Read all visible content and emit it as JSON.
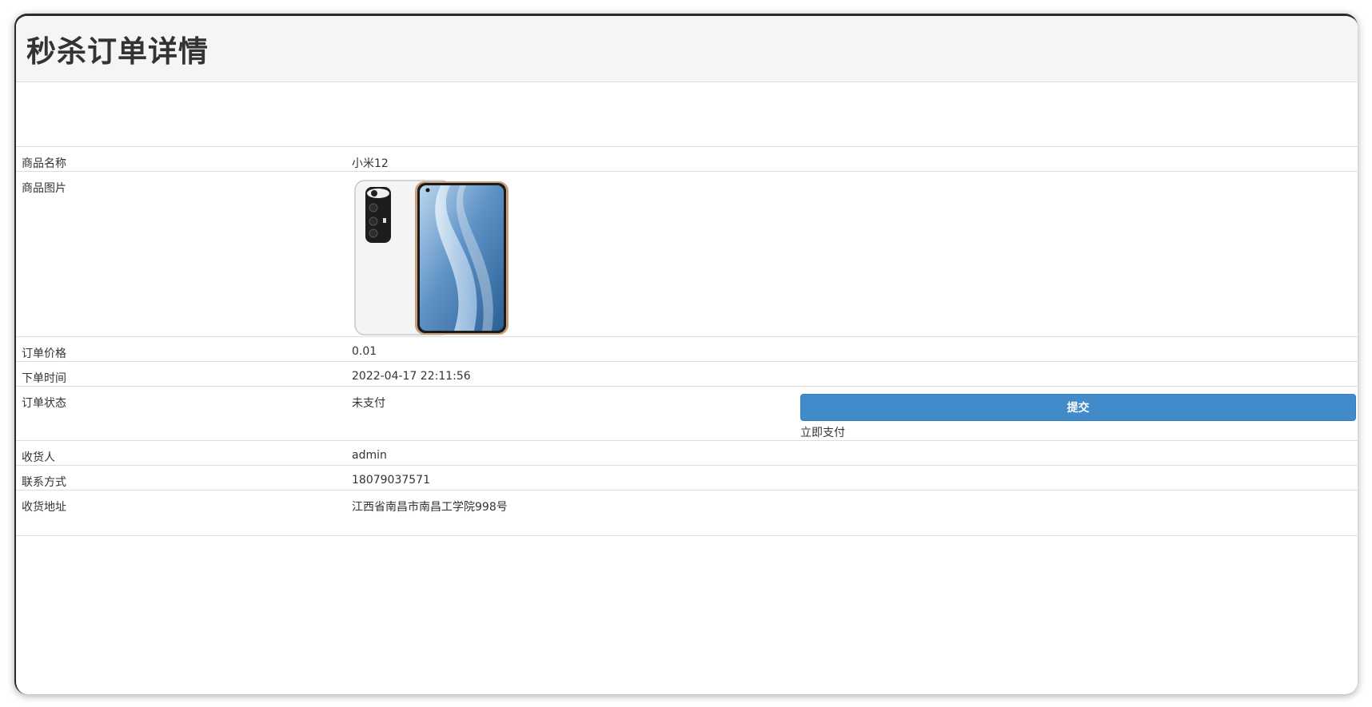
{
  "page": {
    "title": "秒杀订单详情"
  },
  "rows": {
    "product_name": {
      "label": "商品名称",
      "value": "小米12"
    },
    "product_image": {
      "label": "商品图片"
    },
    "order_price": {
      "label": "订单价格",
      "value": "0.01"
    },
    "order_time": {
      "label": "下单时间",
      "value": "2022-04-17 22:11:56"
    },
    "order_status": {
      "label": "订单状态",
      "value": "未支付",
      "submit_label": "提交",
      "pay_label": "立即支付"
    },
    "receiver": {
      "label": "收货人",
      "value": "admin"
    },
    "contact": {
      "label": "联系方式",
      "value": "18079037571"
    },
    "address": {
      "label": "收货地址",
      "value": "江西省南昌市南昌工学院998号"
    }
  },
  "colors": {
    "primary_button": "#428bca",
    "heading_bg": "#f5f5f5"
  }
}
